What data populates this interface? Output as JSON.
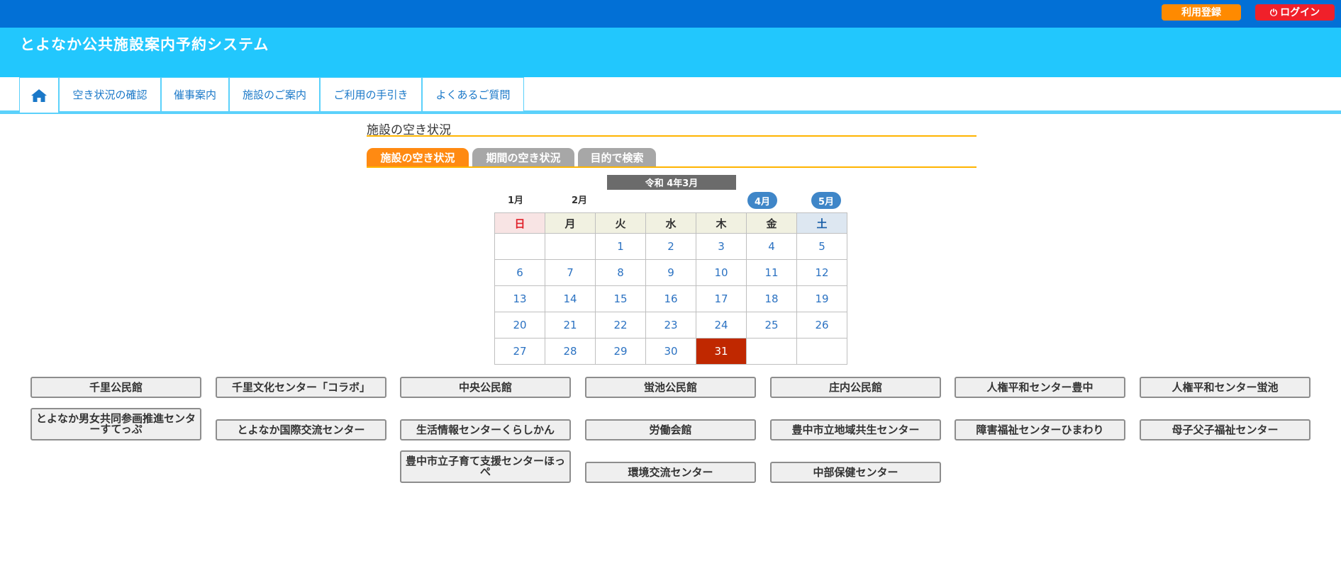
{
  "topbar": {
    "register_label": "利用登録",
    "login_label": "ログイン"
  },
  "header": {
    "title": "とよなか公共施設案内予約システム"
  },
  "nav": {
    "home_icon": "home-icon",
    "items": [
      {
        "label": "空き状況の確認"
      },
      {
        "label": "催事案内"
      },
      {
        "label": "施設のご案内"
      },
      {
        "label": "ご利用の手引き"
      },
      {
        "label": "よくあるご質問"
      }
    ]
  },
  "section": {
    "title": "施設の空き状況"
  },
  "tabs": [
    {
      "label": "施設の空き状況",
      "active": true
    },
    {
      "label": "期間の空き状況",
      "active": false
    },
    {
      "label": "目的で検索",
      "active": false
    }
  ],
  "calendar": {
    "title": "令和 4年3月",
    "prev_months": [
      "1月",
      "2月"
    ],
    "next_months": [
      "4月",
      "5月"
    ],
    "weekdays": [
      "日",
      "月",
      "火",
      "水",
      "木",
      "金",
      "土"
    ],
    "weeks": [
      [
        "",
        "",
        "1",
        "2",
        "3",
        "4",
        "5"
      ],
      [
        "6",
        "7",
        "8",
        "9",
        "10",
        "11",
        "12"
      ],
      [
        "13",
        "14",
        "15",
        "16",
        "17",
        "18",
        "19"
      ],
      [
        "20",
        "21",
        "22",
        "23",
        "24",
        "25",
        "26"
      ],
      [
        "27",
        "28",
        "29",
        "30",
        "31",
        "",
        ""
      ]
    ],
    "today": "31",
    "today_color": "#c02800"
  },
  "facilities": [
    [
      "千里公民館",
      "千里文化センター「コラボ」",
      "中央公民館",
      "蛍池公民館",
      "庄内公民館",
      "人権平和センター豊中",
      "人権平和センター蛍池"
    ],
    [
      "とよなか男女共同参画推進センターすてっぷ",
      "とよなか国際交流センター",
      "生活情報センターくらしかん",
      "労働会館",
      "豊中市立地域共生センター",
      "障害福祉センターひまわり",
      "母子父子福祉センター"
    ],
    [
      "豊中市立子育て支援センターほっぺ",
      "環境交流センター",
      "中部保健センター"
    ]
  ],
  "colors": {
    "topbar": "#0270d6",
    "header": "#22c7fd",
    "nav_border": "#5bd1fb",
    "accent_orange": "#ff8a12",
    "login_red": "#f0202a",
    "link_blue": "#2b72c2"
  }
}
